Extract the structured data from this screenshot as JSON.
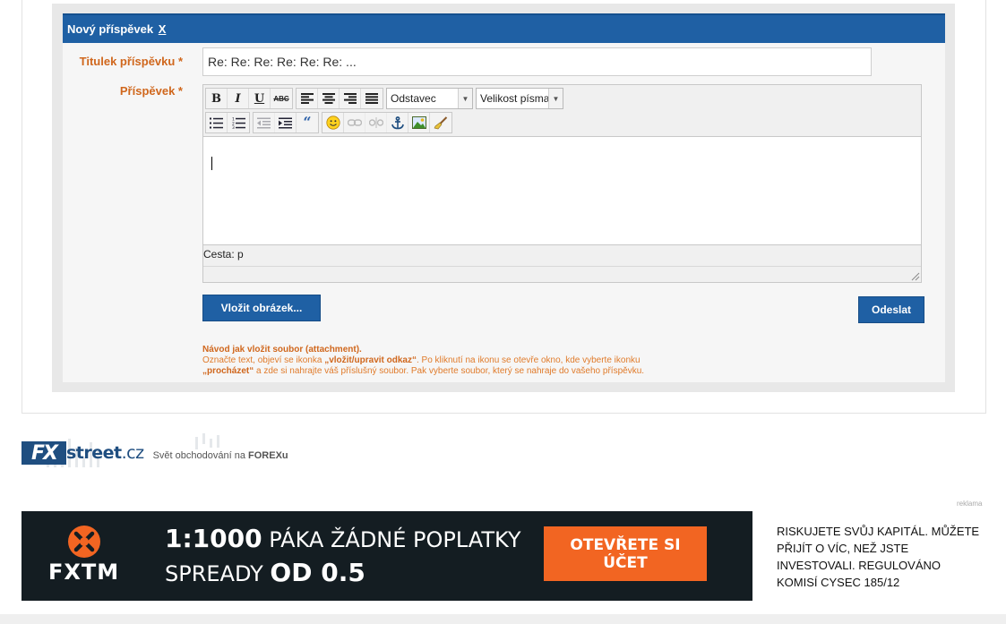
{
  "form": {
    "header_title": "Nový příspěvek",
    "close_label": "X",
    "title_label": "Titulek příspěvku *",
    "title_value": "Re: Re: Re: Re: Re: Re: ...",
    "body_label": "Příspěvek *"
  },
  "editor": {
    "buttons": {
      "bold": "B",
      "italic": "I",
      "underline": "U",
      "strike": "ABC"
    },
    "format_select": "Odstavec",
    "size_select": "Velikost písma",
    "icons_row1": [
      "bold-icon",
      "italic-icon",
      "underline-icon",
      "strikethrough-icon",
      "align-left-icon",
      "align-center-icon",
      "align-right-icon",
      "align-justify-icon"
    ],
    "icons_row2": [
      "bullet-list-icon",
      "numbered-list-icon",
      "outdent-icon",
      "indent-icon",
      "blockquote-icon",
      "smiley-icon",
      "link-icon",
      "unlink-icon",
      "anchor-icon",
      "image-icon",
      "cleanup-icon"
    ],
    "path_label": "Cesta: p"
  },
  "actions": {
    "insert_image": "Vložit obrázek...",
    "submit": "Odeslat"
  },
  "help": {
    "title": "Návod jak vložit soubor (attachment).",
    "line1_a": "Označte text, objeví se ikonka ",
    "line1_b": "„vložit/upravit odkaz“",
    "line1_c": ". Po kliknutí na ikonu se otevře okno, kde vyberte ikonku",
    "line2_a": "„procházet“",
    "line2_b": " a zde si nahrajte váš příslušný soubor. Pak vyberte soubor, který se nahraje do vašeho příspěvku."
  },
  "footer_logo": {
    "fx": "FX",
    "street": "street",
    "cz": ".cz",
    "tagline_a": "Svět obchodování na ",
    "tagline_b": "FOREXu"
  },
  "ad": {
    "label": "reklama",
    "brand": "FXTM",
    "line1_big": "1:1000",
    "line1_rest": " PÁKA ŽÁDNÉ POPLATKY",
    "line2_rest": "SPREADY ",
    "line2_big": "OD 0.5",
    "cta": "OTEVŘETE SI ÚČET",
    "risk_text": "RISKUJETE SVŮJ KAPITÁL. MŮŽETE PŘIJÍT O VÍC, NEŽ JSTE INVESTOVALI. REGULOVÁNO KOMISÍ CYSEC 185/12",
    "colors": {
      "bg": "#141d22",
      "accent": "#f26522"
    }
  },
  "colors": {
    "header_blue": "#1f60a4",
    "label_orange": "#d0671d",
    "help_orange": "#e07b2b"
  }
}
